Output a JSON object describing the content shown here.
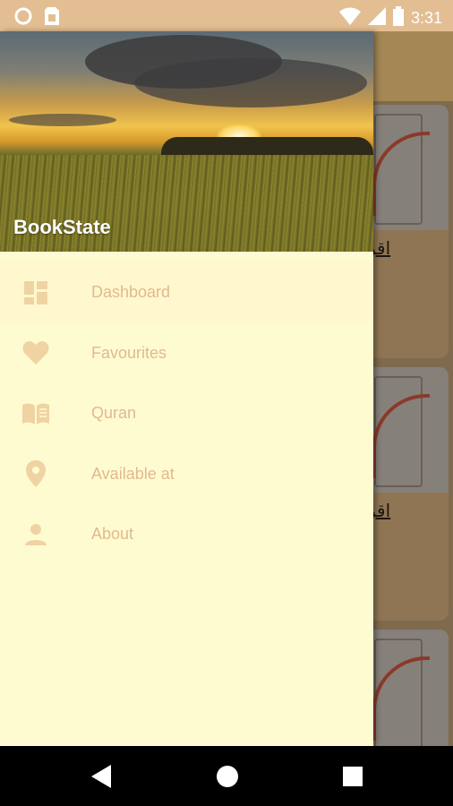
{
  "status_bar": {
    "time": "3:31",
    "icons": [
      "circle-icon",
      "sim-card-icon",
      "wifi-icon",
      "cellular-signal-icon",
      "battery-icon"
    ]
  },
  "background": {
    "card_title": "اقر"
  },
  "drawer": {
    "app_name": "BookState",
    "items": [
      {
        "label": "Dashboard",
        "icon": "dashboard-icon"
      },
      {
        "label": "Favourites",
        "icon": "heart-icon"
      },
      {
        "label": "Quran",
        "icon": "open-book-icon"
      },
      {
        "label": "Available at",
        "icon": "location-pin-icon"
      },
      {
        "label": "About",
        "icon": "person-icon"
      }
    ]
  },
  "nav_bar": {
    "icons": [
      "back-icon",
      "home-icon",
      "recents-icon"
    ]
  },
  "colors": {
    "status_bar": "#e3be93",
    "drawer_bg": "#fffbd1",
    "menu_text": "#e2b98f",
    "menu_icon": "#f0d3a2"
  }
}
